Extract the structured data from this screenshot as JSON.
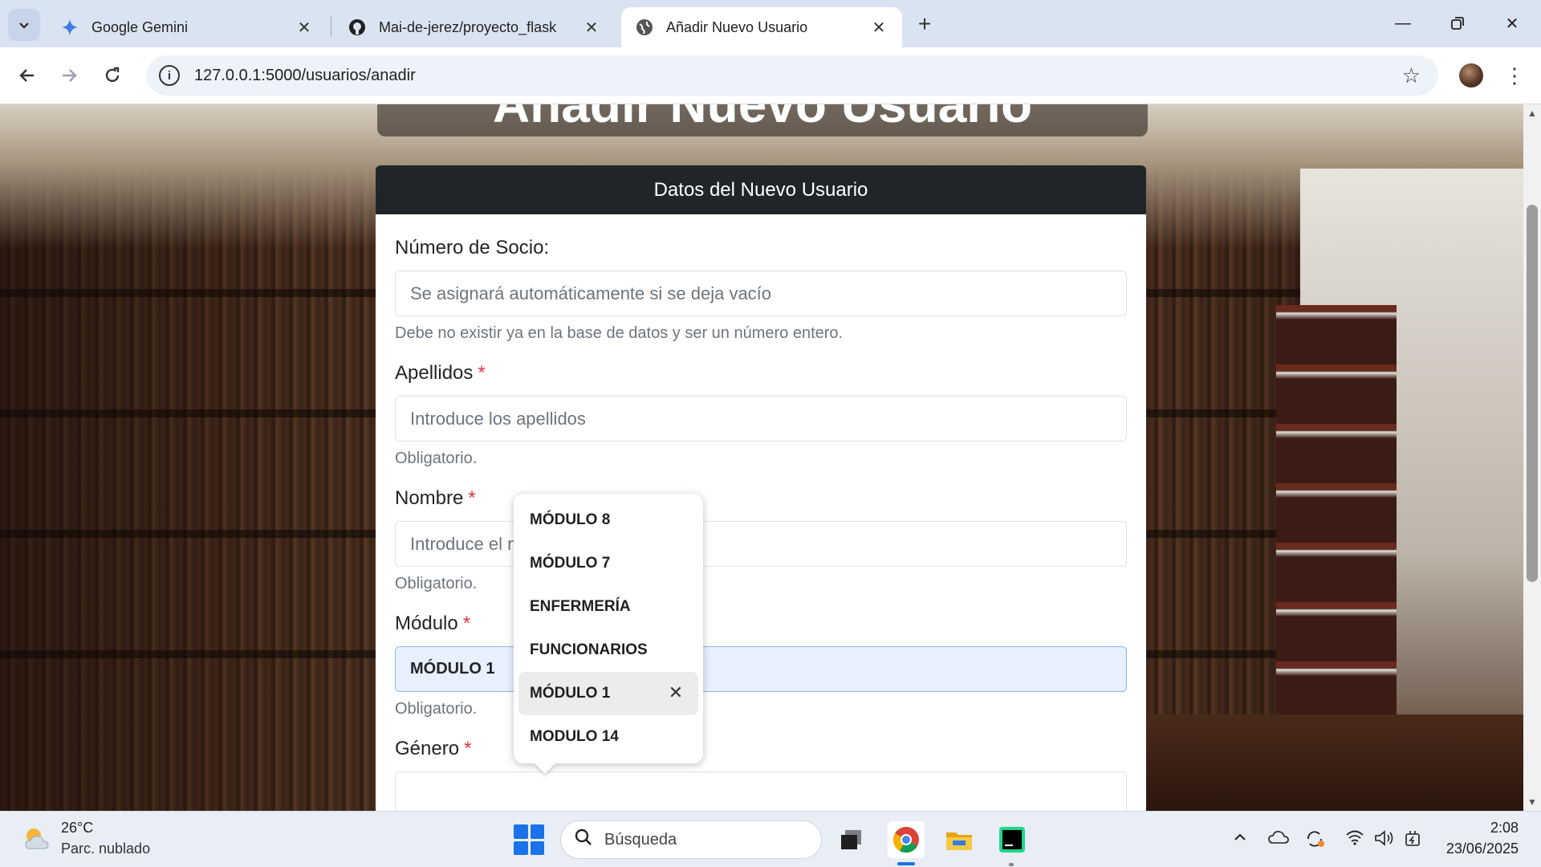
{
  "browser": {
    "tabs": [
      {
        "title": "Google Gemini",
        "icon": "gemini-icon"
      },
      {
        "title": "Mai-de-jerez/proyecto_flask",
        "icon": "github-icon"
      },
      {
        "title": "Añadir Nuevo Usuario",
        "icon": "globe-icon",
        "active": true
      }
    ],
    "url": "127.0.0.1:5000/usuarios/anadir"
  },
  "page": {
    "heading": "Añadir Nuevo Usuario",
    "card_title": "Datos del Nuevo Usuario",
    "form": {
      "numero_socio": {
        "label": "Número de Socio:",
        "placeholder": "Se asignará automáticamente si se deja vacío",
        "help": "Debe no existir ya en la base de datos y ser un número entero."
      },
      "apellidos": {
        "label": "Apellidos",
        "required_mark": "*",
        "placeholder": "Introduce los apellidos",
        "help": "Obligatorio."
      },
      "nombre": {
        "label": "Nombre",
        "required_mark": "*",
        "placeholder": "Introduce el nombre",
        "help": "Obligatorio."
      },
      "modulo": {
        "label": "Módulo",
        "required_mark": "*",
        "value": "MÓDULO 1",
        "help": "Obligatorio."
      },
      "genero": {
        "label": "Género",
        "required_mark": "*"
      }
    },
    "autocomplete": {
      "items": [
        "MÓDULO 8",
        "MÓDULO 7",
        "ENFERMERÍA",
        "FUNCIONARIOS",
        "MÓDULO 1",
        "MODULO 14"
      ],
      "highlighted": "MÓDULO 1"
    }
  },
  "taskbar": {
    "weather_temp": "26°C",
    "weather_desc": "Parc. nublado",
    "search_placeholder": "Búsqueda",
    "time": "2:08",
    "date": "23/06/2025"
  },
  "colors": {
    "card_header_bg": "#212529",
    "required": "#dc3545",
    "autofill_bg": "#e8f0fe",
    "accent": "#1a73e8"
  }
}
